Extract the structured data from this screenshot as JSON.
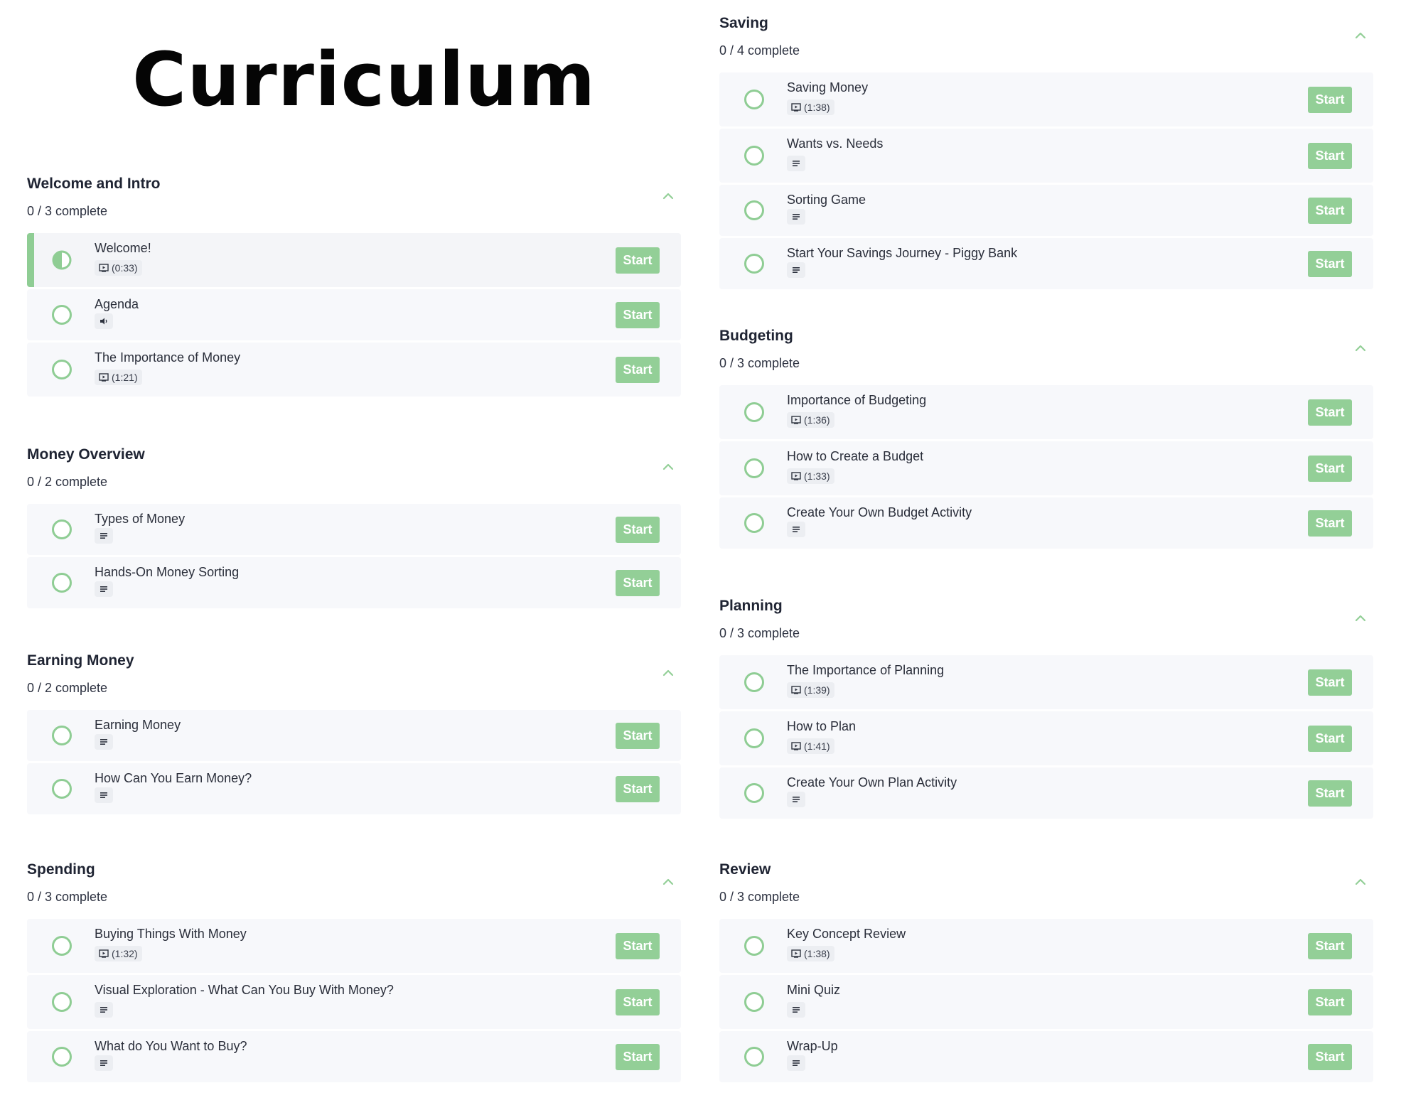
{
  "page_title": "Curriculum",
  "start_label": "Start",
  "accent_color": "#93cf97",
  "left_sections": [
    {
      "title": "Welcome and Intro",
      "progress": "0 / 3 complete",
      "lessons": [
        {
          "title": "Welcome!",
          "type": "video",
          "duration": "(0:33)",
          "active": true
        },
        {
          "title": "Agenda",
          "type": "audio",
          "duration": ""
        },
        {
          "title": "The Importance of Money",
          "type": "video",
          "duration": "(1:21)"
        }
      ]
    },
    {
      "title": "Money Overview",
      "progress": "0 / 2 complete",
      "lessons": [
        {
          "title": "Types of Money",
          "type": "text",
          "duration": ""
        },
        {
          "title": "Hands-On Money Sorting",
          "type": "text",
          "duration": ""
        }
      ]
    },
    {
      "title": "Earning Money",
      "progress": "0 / 2 complete",
      "lessons": [
        {
          "title": "Earning Money",
          "type": "text",
          "duration": ""
        },
        {
          "title": "How Can You Earn Money?",
          "type": "text",
          "duration": ""
        }
      ]
    },
    {
      "title": "Spending",
      "progress": "0 / 3 complete",
      "lessons": [
        {
          "title": "Buying Things With Money",
          "type": "video",
          "duration": "(1:32)"
        },
        {
          "title": "Visual Exploration - What Can You Buy With Money?",
          "type": "text",
          "duration": ""
        },
        {
          "title": "What do You Want to Buy?",
          "type": "text",
          "duration": ""
        }
      ]
    }
  ],
  "right_sections": [
    {
      "title": "Saving",
      "progress": "0 / 4 complete",
      "lessons": [
        {
          "title": "Saving Money",
          "type": "video",
          "duration": "(1:38)"
        },
        {
          "title": "Wants vs. Needs",
          "type": "text",
          "duration": ""
        },
        {
          "title": "Sorting Game",
          "type": "text",
          "duration": ""
        },
        {
          "title": "Start Your Savings Journey - Piggy Bank",
          "type": "text",
          "duration": ""
        }
      ]
    },
    {
      "title": "Budgeting",
      "progress": "0 / 3 complete",
      "lessons": [
        {
          "title": "Importance of Budgeting",
          "type": "video",
          "duration": "(1:36)"
        },
        {
          "title": "How to Create a Budget",
          "type": "video",
          "duration": "(1:33)"
        },
        {
          "title": "Create Your Own Budget Activity",
          "type": "text",
          "duration": ""
        }
      ]
    },
    {
      "title": "Planning",
      "progress": "0 / 3 complete",
      "lessons": [
        {
          "title": "The Importance of Planning",
          "type": "video",
          "duration": "(1:39)"
        },
        {
          "title": "How to Plan",
          "type": "video",
          "duration": "(1:41)"
        },
        {
          "title": "Create Your Own Plan Activity",
          "type": "text",
          "duration": ""
        }
      ]
    },
    {
      "title": "Review",
      "progress": "0 / 3 complete",
      "lessons": [
        {
          "title": "Key Concept Review",
          "type": "video",
          "duration": "(1:38)"
        },
        {
          "title": "Mini Quiz",
          "type": "text",
          "duration": ""
        },
        {
          "title": "Wrap-Up",
          "type": "text",
          "duration": ""
        }
      ]
    }
  ]
}
